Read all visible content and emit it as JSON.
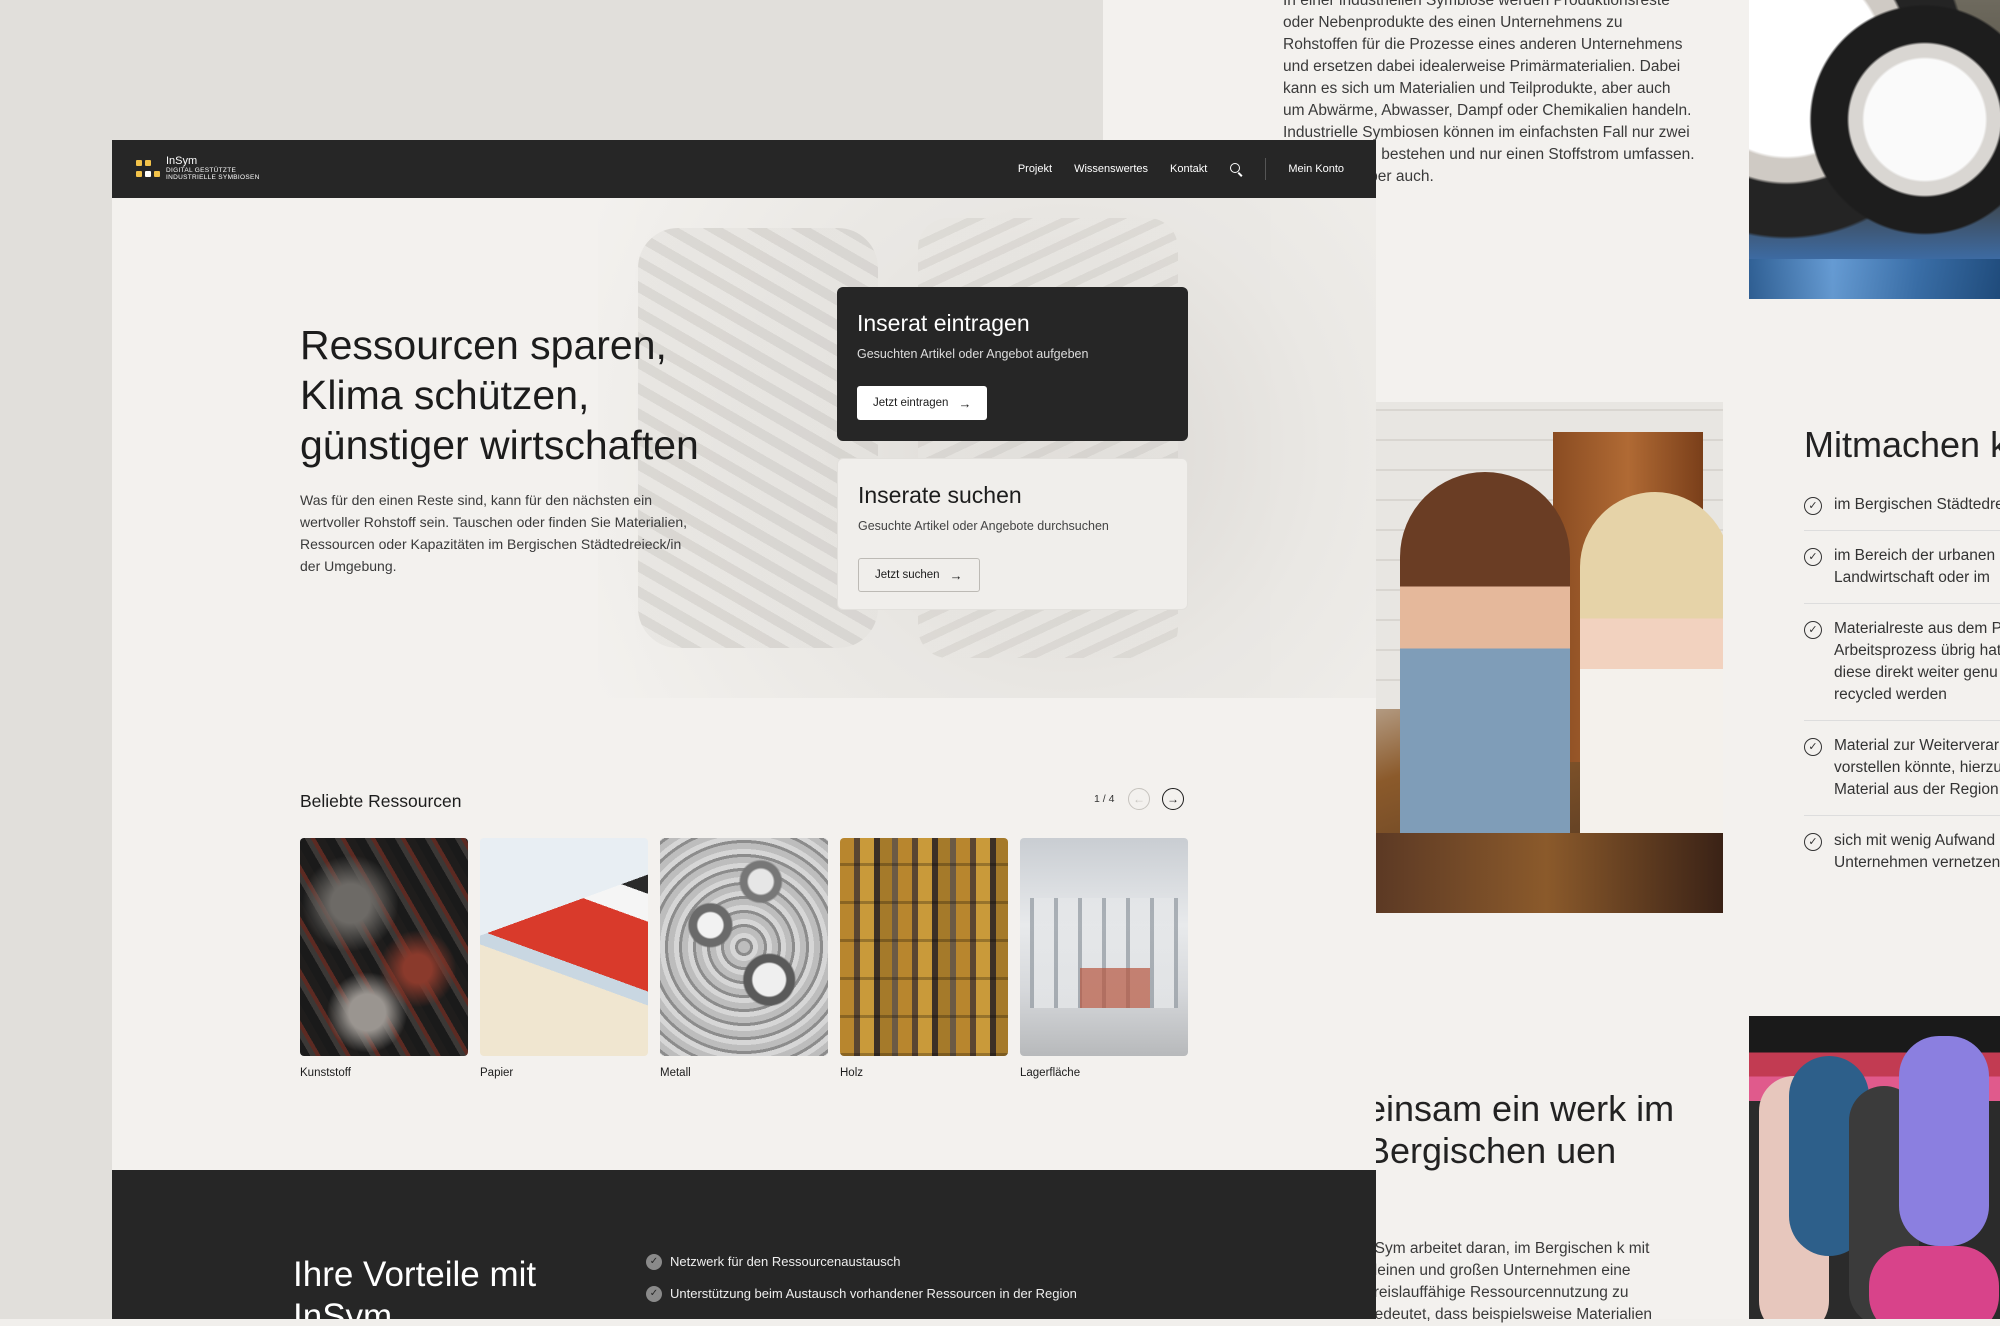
{
  "background": {
    "intro_paragraph": "In einer industriellen Symbiose werden Produktionsreste oder Nebenprodukte des einen Unternehmens zu Rohstoffen für die Prozesse eines anderen Unternehmens und ersetzen dabei idealerweise Primärmaterialien. Dabei kann es sich um Materialien und Teilprodukte, aber auch um Abwärme, Abwasser, Dampf oder Chemikalien handeln. Industrielle Symbiosen können im einfachsten Fall nur zwei Unternehmen bestehen und nur einen Stoffstrom umfassen. Möglich ist aber auch.",
    "mitmachen_title": "Mitmachen k",
    "mitmachen_items": [
      "im Bergischen Städtedreieck",
      "im Bereich der urbanen L",
      "Landwirtschaft oder im",
      "Materialreste aus dem P",
      "Arbeitsprozess übrig hat",
      "diese direkt weiter genu",
      "recycled werden",
      "Material zur Weiterverar",
      "vorstellen könnte, hierzu",
      "Material aus der Region",
      "sich mit wenig Aufwand",
      "Unternehmen vernetzen"
    ],
    "network_title": "einsam ein werk im Bergischen uen",
    "network_paragraph": "nSym arbeitet daran, im Bergischen k mit kleinen und großen Unternehmen eine kreislauffähige Ressourcennutzung zu bedeutet, dass beispielsweise Materialien"
  },
  "nav": {
    "brand": "InSym",
    "brand_sub1": "DIGITAL GESTÜTZTE",
    "brand_sub2": "INDUSTRIELLE SYMBIOSEN",
    "links": [
      "Projekt",
      "Wissenswertes",
      "Kontakt"
    ],
    "account": "Mein Konto"
  },
  "hero": {
    "title_line1": "Ressourcen sparen,",
    "title_line2": "Klima schützen,",
    "title_line3": "günstiger wirtschaften",
    "text": "Was für den einen Reste sind, kann für den nächsten ein wertvoller Rohstoff sein. Tauschen oder finden Sie Materialien, Ressourcen oder Kapazitäten im Bergischen Städtedreieck/in der Umgebung."
  },
  "cards": {
    "post": {
      "title": "Inserat eintragen",
      "subtitle": "Gesuchten Artikel oder Angebot aufgeben",
      "button": "Jetzt eintragen"
    },
    "search": {
      "title": "Inserate suchen",
      "subtitle": "Gesuchte Artikel oder Angebote durchsuchen",
      "button": "Jetzt suchen"
    }
  },
  "resources": {
    "title": "Beliebte Ressourcen",
    "pager": "1 / 4",
    "items": [
      "Kunststoff",
      "Papier",
      "Metall",
      "Holz",
      "Lagerfläche"
    ]
  },
  "benefits": {
    "title": "Ihre Vorteile mit InSym",
    "items": [
      "Netzwerk für den Ressourcenaustausch",
      "Unterstützung beim Austausch vorhandener Ressourcen in der Region"
    ]
  },
  "colors": {
    "dark": "#262626",
    "accent": "#f3c34a",
    "page_bg": "#f3f1ee"
  }
}
